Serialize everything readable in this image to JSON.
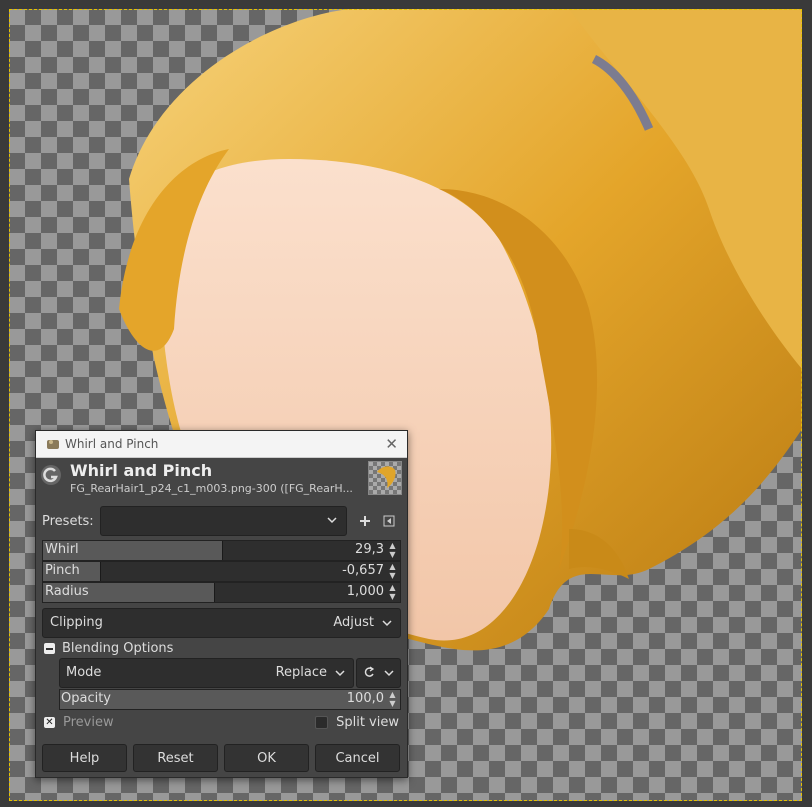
{
  "dialog": {
    "window_title": "Whirl and Pinch",
    "header_title": "Whirl and Pinch",
    "header_subtitle": "FG_RearHair1_p24_c1_m003.png-300 ([FG_RearH...",
    "presets_label": "Presets:",
    "presets_value": "",
    "sliders": [
      {
        "label": "Whirl",
        "value": "29,3",
        "fill_fraction": 0.5
      },
      {
        "label": "Pinch",
        "value": "-0,657",
        "fill_fraction": 0.16
      },
      {
        "label": "Radius",
        "value": "1,000",
        "fill_fraction": 0.48
      }
    ],
    "clipping_label": "Clipping",
    "clipping_value": "Adjust",
    "blending_label": "Blending Options",
    "mode_label": "Mode",
    "mode_value": "Replace",
    "opacity_label": "Opacity",
    "opacity_value": "100,0",
    "preview_label": "Preview",
    "split_view_label": "Split view",
    "buttons": {
      "help": "Help",
      "reset": "Reset",
      "ok": "OK",
      "cancel": "Cancel"
    }
  },
  "colors": {
    "hair": "#e0a52a",
    "hair_dark": "#b07a16",
    "face": "#f5d0b8",
    "dialog_bg": "#454545"
  }
}
